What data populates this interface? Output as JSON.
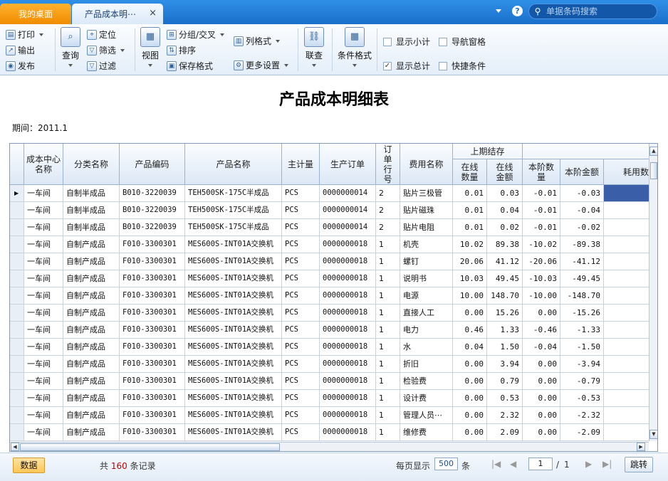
{
  "tabs": {
    "home": "我的桌面",
    "active": "产品成本明⋯",
    "close": "×"
  },
  "search": {
    "placeholder": "单据条码搜索"
  },
  "toolbar": {
    "print": "打印",
    "export": "输出",
    "publish": "发布",
    "query": "查询",
    "locate": "定位",
    "filter": "筛选",
    "filter2": "过滤",
    "view": "视图",
    "group": "分组/交叉",
    "sort": "排序",
    "save_format": "保存格式",
    "col_format": "列格式",
    "more_settings": "更多设置",
    "link": "联查",
    "cond_format": "条件格式",
    "show_subtotal": "显示小计",
    "nav_pane": "导航窗格",
    "show_total": "显示总计",
    "quick_cond": "快捷条件"
  },
  "report": {
    "title": "产品成本明细表",
    "period": "期间：2011.1"
  },
  "columns": {
    "cost_center": "成本中心名称",
    "category": "分类名称",
    "product_code": "产品编码",
    "product_name": "产品名称",
    "unit": "主计量",
    "order": "生产订单",
    "line": "订单行号",
    "fee": "费用名称",
    "prev_group": "上期结存",
    "prev_qty": "在线数量",
    "prev_amt": "在线金额",
    "cur_qty": "本阶数量",
    "cur_amt": "本阶金额",
    "consume": "耗用数"
  },
  "rows": [
    [
      "一车间",
      "自制半成品",
      "B010-3220039",
      "TEH500SK-175C半成品",
      "PCS",
      "0000000014",
      "2",
      "贴片三极管",
      "0.01",
      "0.03",
      "-0.01",
      "-0.03"
    ],
    [
      "一车间",
      "自制半成品",
      "B010-3220039",
      "TEH500SK-175C半成品",
      "PCS",
      "0000000014",
      "2",
      "贴片磁珠",
      "0.01",
      "0.04",
      "-0.01",
      "-0.04"
    ],
    [
      "一车间",
      "自制半成品",
      "B010-3220039",
      "TEH500SK-175C半成品",
      "PCS",
      "0000000014",
      "2",
      "贴片电阻",
      "0.01",
      "0.02",
      "-0.01",
      "-0.02"
    ],
    [
      "一车间",
      "自制产成品",
      "F010-3300301",
      "MES600S-INT01A交换机",
      "PCS",
      "0000000018",
      "1",
      "机壳",
      "10.02",
      "89.38",
      "-10.02",
      "-89.38"
    ],
    [
      "一车间",
      "自制产成品",
      "F010-3300301",
      "MES600S-INT01A交换机",
      "PCS",
      "0000000018",
      "1",
      "螺钉",
      "20.06",
      "41.12",
      "-20.06",
      "-41.12"
    ],
    [
      "一车间",
      "自制产成品",
      "F010-3300301",
      "MES600S-INT01A交换机",
      "PCS",
      "0000000018",
      "1",
      "说明书",
      "10.03",
      "49.45",
      "-10.03",
      "-49.45"
    ],
    [
      "一车间",
      "自制产成品",
      "F010-3300301",
      "MES600S-INT01A交换机",
      "PCS",
      "0000000018",
      "1",
      "电源",
      "10.00",
      "148.70",
      "-10.00",
      "-148.70"
    ],
    [
      "一车间",
      "自制产成品",
      "F010-3300301",
      "MES600S-INT01A交换机",
      "PCS",
      "0000000018",
      "1",
      "直接人工",
      "0.00",
      "15.26",
      "0.00",
      "-15.26"
    ],
    [
      "一车间",
      "自制产成品",
      "F010-3300301",
      "MES600S-INT01A交换机",
      "PCS",
      "0000000018",
      "1",
      "电力",
      "0.46",
      "1.33",
      "-0.46",
      "-1.33"
    ],
    [
      "一车间",
      "自制产成品",
      "F010-3300301",
      "MES600S-INT01A交换机",
      "PCS",
      "0000000018",
      "1",
      "水",
      "0.04",
      "1.50",
      "-0.04",
      "-1.50"
    ],
    [
      "一车间",
      "自制产成品",
      "F010-3300301",
      "MES600S-INT01A交换机",
      "PCS",
      "0000000018",
      "1",
      "折旧",
      "0.00",
      "3.94",
      "0.00",
      "-3.94"
    ],
    [
      "一车间",
      "自制产成品",
      "F010-3300301",
      "MES600S-INT01A交换机",
      "PCS",
      "0000000018",
      "1",
      "检验费",
      "0.00",
      "0.79",
      "0.00",
      "-0.79"
    ],
    [
      "一车间",
      "自制产成品",
      "F010-3300301",
      "MES600S-INT01A交换机",
      "PCS",
      "0000000018",
      "1",
      "设计费",
      "0.00",
      "0.53",
      "0.00",
      "-0.53"
    ],
    [
      "一车间",
      "自制产成品",
      "F010-3300301",
      "MES600S-INT01A交换机",
      "PCS",
      "0000000018",
      "1",
      "管理人员⋯",
      "0.00",
      "2.32",
      "0.00",
      "-2.32"
    ],
    [
      "一车间",
      "自制产成品",
      "F010-3300301",
      "MES600S-INT01A交换机",
      "PCS",
      "0000000018",
      "1",
      "维修费",
      "0.00",
      "2.09",
      "0.00",
      "-2.09"
    ]
  ],
  "footer": {
    "data_btn": "数据",
    "total_prefix": "共",
    "total_count": "160",
    "total_suffix": "条记录",
    "per_page_label": "每页显示",
    "per_page": "500",
    "per_page_unit": "条",
    "page": "1",
    "page_sep": "/",
    "page_total": "1",
    "jump": "跳转"
  },
  "colors": {
    "accent": "#1a6fcb",
    "home_tab": "#f08c00",
    "selection": "#3a5fa8",
    "count": "#c00000"
  }
}
